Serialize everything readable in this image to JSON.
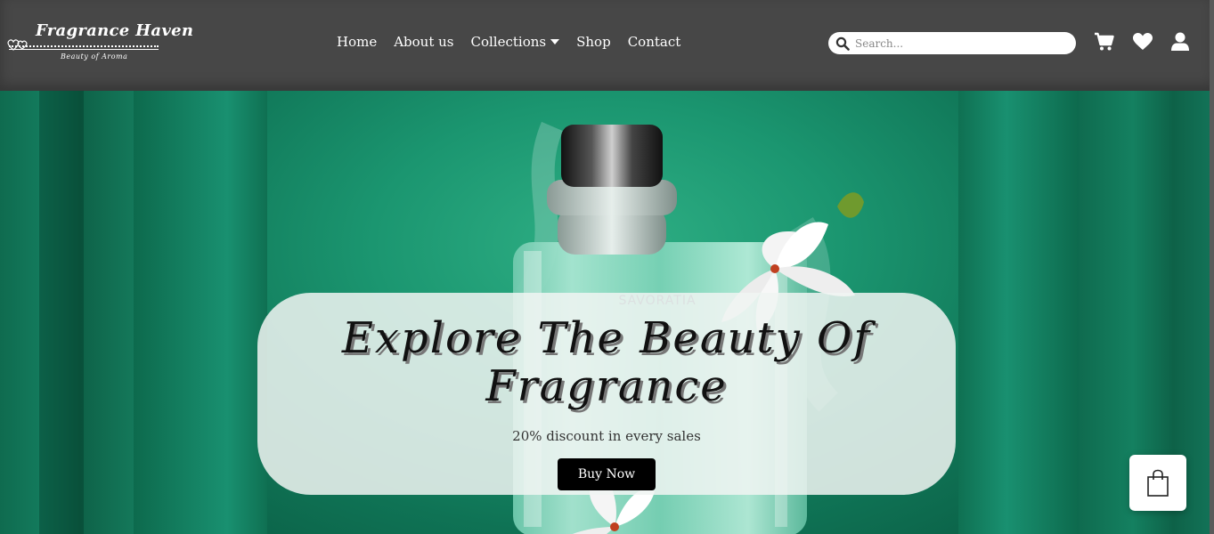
{
  "header": {
    "logo": {
      "title": "Fragrance Haven",
      "tagline": "Beauty of Aroma"
    },
    "nav": [
      {
        "label": "Home"
      },
      {
        "label": "About us"
      },
      {
        "label": "Collections"
      },
      {
        "label": "Shop"
      },
      {
        "label": "Contact"
      }
    ],
    "search": {
      "placeholder": "Search...",
      "value": ""
    },
    "icons": [
      "cart-icon",
      "heart-icon",
      "user-icon"
    ]
  },
  "hero": {
    "title": "Explore The Beauty Of Fragrance",
    "subtitle": "20% discount in every sales",
    "button_label": "Buy Now",
    "bottle_label": "SAVORATIA"
  },
  "floating": {
    "icon": "shopping-bag-icon"
  },
  "colors": {
    "header_bg": "#474747",
    "hero_green": "#13755a",
    "button_bg": "#000000",
    "overlay": "#f0f5f2"
  }
}
